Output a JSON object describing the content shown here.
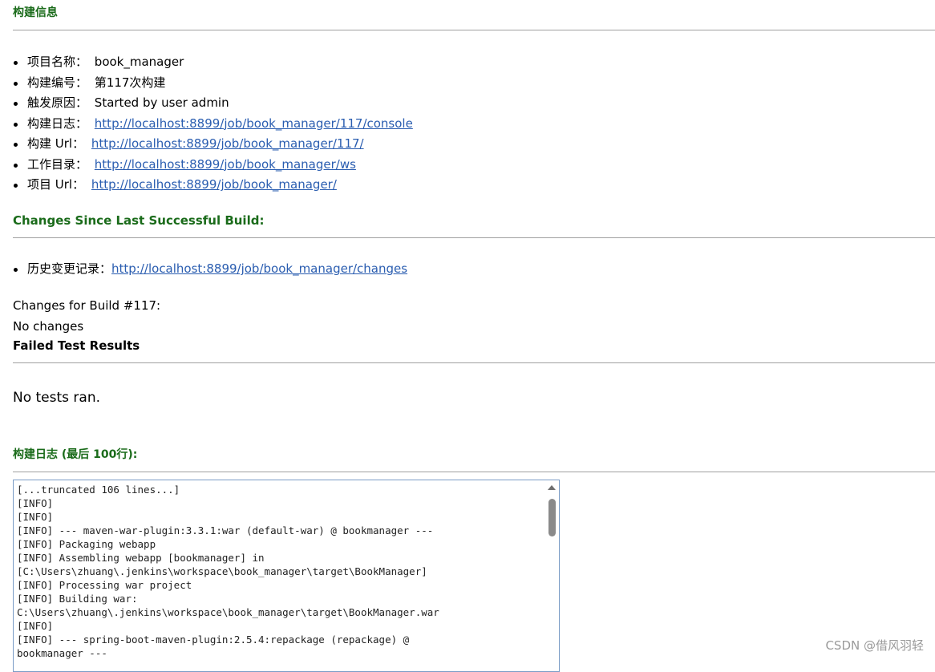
{
  "build_info": {
    "title": "构建信息",
    "items": [
      {
        "label": "项目名称：",
        "value": "book_manager"
      },
      {
        "label": "构建编号：",
        "value": "第117次构建"
      },
      {
        "label": "触发原因：",
        "value": "Started by user admin"
      },
      {
        "label": "构建日志：",
        "link": "http://localhost:8899/job/book_manager/117/console"
      },
      {
        "label": "构建  Url：",
        "link": "http://localhost:8899/job/book_manager/117/"
      },
      {
        "label": "工作目录：",
        "link": "http://localhost:8899/job/book_manager/ws"
      },
      {
        "label": "项目  Url：",
        "link": "http://localhost:8899/job/book_manager/"
      }
    ]
  },
  "changes": {
    "title": "Changes Since Last Successful Build:",
    "history_label": "历史变更记录：",
    "history_link": "http://localhost:8899/job/book_manager/changes",
    "changes_for": "Changes for Build #117:",
    "no_changes": "No changes"
  },
  "tests": {
    "title": "Failed Test Results",
    "message": "No tests ran."
  },
  "console": {
    "title": "构建日志 (最后 100行):",
    "lines": [
      "[...truncated 106 lines...]",
      "[INFO]",
      "[INFO]",
      "[INFO] --- maven-war-plugin:3.3.1:war (default-war) @ bookmanager ---",
      "[INFO] Packaging webapp",
      "[INFO] Assembling webapp [bookmanager] in",
      "[C:\\Users\\zhuang\\.jenkins\\workspace\\book_manager\\target\\BookManager]",
      "[INFO] Processing war project",
      "[INFO] Building war:",
      "C:\\Users\\zhuang\\.jenkins\\workspace\\book_manager\\target\\BookManager.war",
      "[INFO]",
      "[INFO] --- spring-boot-maven-plugin:2.5.4:repackage (repackage) @",
      "bookmanager ---"
    ]
  },
  "watermark": "CSDN @借风羽轻"
}
